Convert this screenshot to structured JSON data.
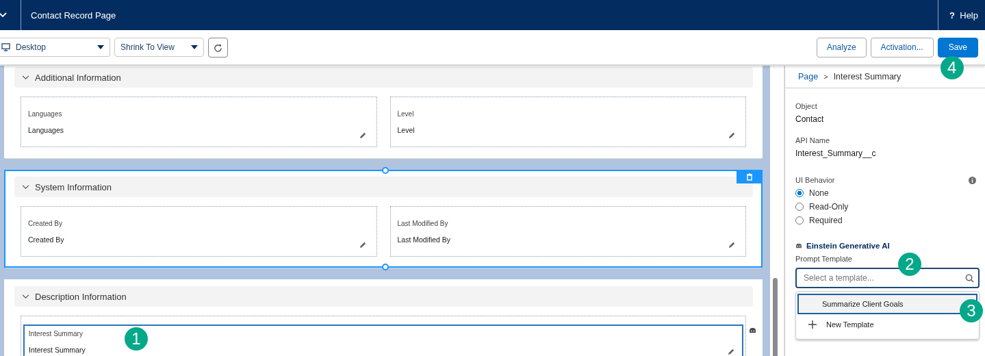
{
  "header": {
    "title": "Contact Record Page",
    "help": {
      "glyph": "?",
      "label": "Help"
    }
  },
  "toolbar": {
    "device": "Desktop",
    "zoom": "Shrink To View",
    "buttons": [
      {
        "label": "Analyze",
        "kind": "neutral"
      },
      {
        "label": "Activation...",
        "kind": "neutral"
      },
      {
        "label": "Save",
        "kind": "brand",
        "callout": "4"
      }
    ]
  },
  "canvas": {
    "sections": [
      {
        "title": "Additional Information",
        "selected": false,
        "fields": [
          {
            "label": "Languages",
            "value": "Languages",
            "selected": false,
            "ai": false
          },
          {
            "label": "Level",
            "value": "Level",
            "selected": false,
            "ai": false
          }
        ]
      },
      {
        "title": "System Information",
        "selected": true,
        "fields": [
          {
            "label": "Created By",
            "value": "Created By",
            "selected": false,
            "ai": false
          },
          {
            "label": "Last Modified By",
            "value": "Last Modified By",
            "selected": false,
            "ai": false
          }
        ]
      },
      {
        "title": "Description Information",
        "selected": false,
        "fields": [
          {
            "label": "Interest Summary",
            "value": "Interest Summary",
            "selected": true,
            "ai": true,
            "callout": "1"
          }
        ]
      }
    ]
  },
  "panel": {
    "breadcrumb": {
      "items": [
        "Page",
        "Interest Summary"
      ],
      "separator": ">"
    },
    "properties": [
      {
        "label": "Object",
        "value": "Contact"
      },
      {
        "label": "API Name",
        "value": "Interest_Summary__c"
      }
    ],
    "ui_behavior": {
      "label": "UI Behavior",
      "options": [
        {
          "label": "None",
          "selected": true
        },
        {
          "label": "Read-Only",
          "selected": false
        },
        {
          "label": "Required",
          "selected": false
        }
      ]
    },
    "einstein": {
      "heading": "Einstein Generative AI",
      "field_label": "Prompt Template",
      "placeholder": "Select a template...",
      "callout": "2",
      "options": [
        {
          "label": "Summarize Client Goals",
          "kind": "item",
          "selected": true,
          "callout": "3"
        },
        {
          "label": "New Template",
          "kind": "new",
          "selected": false
        }
      ]
    }
  }
}
